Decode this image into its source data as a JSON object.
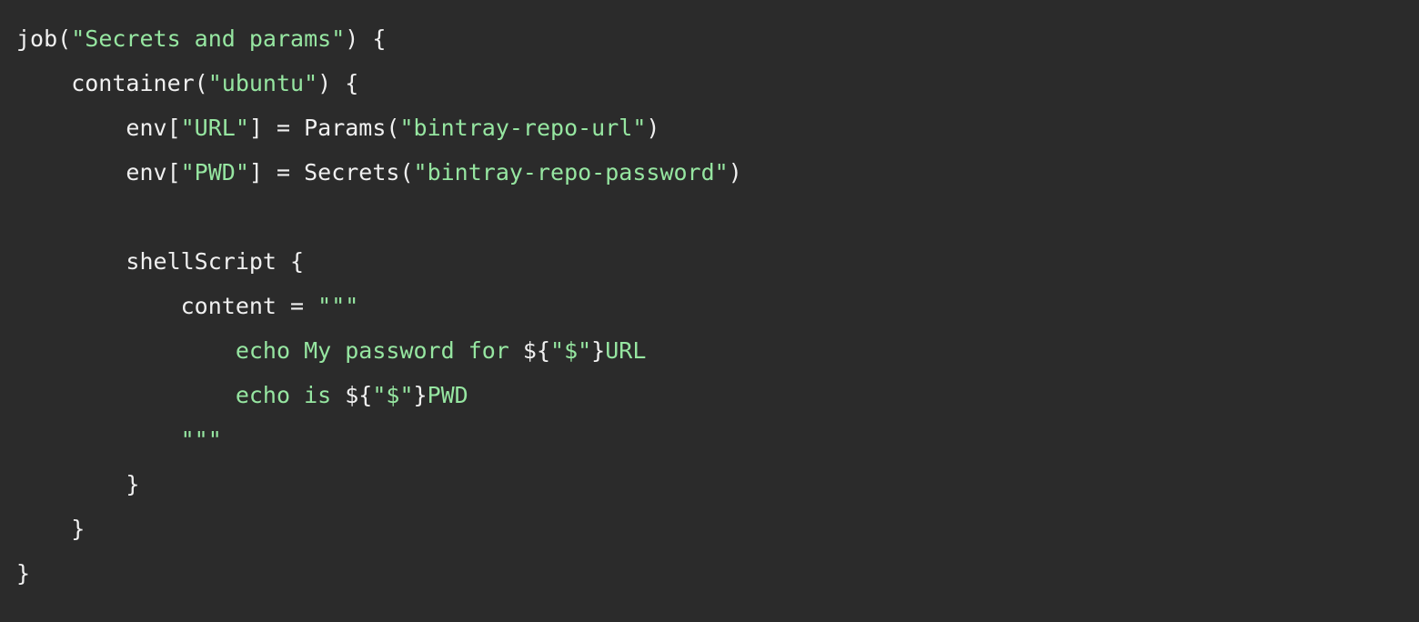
{
  "code": {
    "tokens": [
      [
        {
          "t": "job(",
          "c": "default"
        },
        {
          "t": "\"Secrets and params\"",
          "c": "string"
        },
        {
          "t": ") {",
          "c": "default"
        }
      ],
      [
        {
          "t": "    container(",
          "c": "default"
        },
        {
          "t": "\"ubuntu\"",
          "c": "string"
        },
        {
          "t": ") {",
          "c": "default"
        }
      ],
      [
        {
          "t": "        env[",
          "c": "default"
        },
        {
          "t": "\"URL\"",
          "c": "string"
        },
        {
          "t": "] = Params(",
          "c": "default"
        },
        {
          "t": "\"bintray-repo-url\"",
          "c": "string"
        },
        {
          "t": ")",
          "c": "default"
        }
      ],
      [
        {
          "t": "        env[",
          "c": "default"
        },
        {
          "t": "\"PWD\"",
          "c": "string"
        },
        {
          "t": "] = Secrets(",
          "c": "default"
        },
        {
          "t": "\"bintray-repo-password\"",
          "c": "string"
        },
        {
          "t": ")",
          "c": "default"
        }
      ],
      [],
      [
        {
          "t": "        shellScript {",
          "c": "default"
        }
      ],
      [
        {
          "t": "            content = ",
          "c": "default"
        },
        {
          "t": "\"\"\"",
          "c": "string"
        }
      ],
      [
        {
          "t": "                echo My password for ",
          "c": "string"
        },
        {
          "t": "${",
          "c": "default"
        },
        {
          "t": "\"$\"",
          "c": "string"
        },
        {
          "t": "}",
          "c": "default"
        },
        {
          "t": "URL",
          "c": "string"
        }
      ],
      [
        {
          "t": "                echo is ",
          "c": "string"
        },
        {
          "t": "${",
          "c": "default"
        },
        {
          "t": "\"$\"",
          "c": "string"
        },
        {
          "t": "}",
          "c": "default"
        },
        {
          "t": "PWD",
          "c": "string"
        }
      ],
      [
        {
          "t": "            \"\"\"",
          "c": "string"
        }
      ],
      [
        {
          "t": "        }",
          "c": "default"
        }
      ],
      [
        {
          "t": "    }",
          "c": "default"
        }
      ],
      [
        {
          "t": "}",
          "c": "default"
        }
      ]
    ]
  }
}
